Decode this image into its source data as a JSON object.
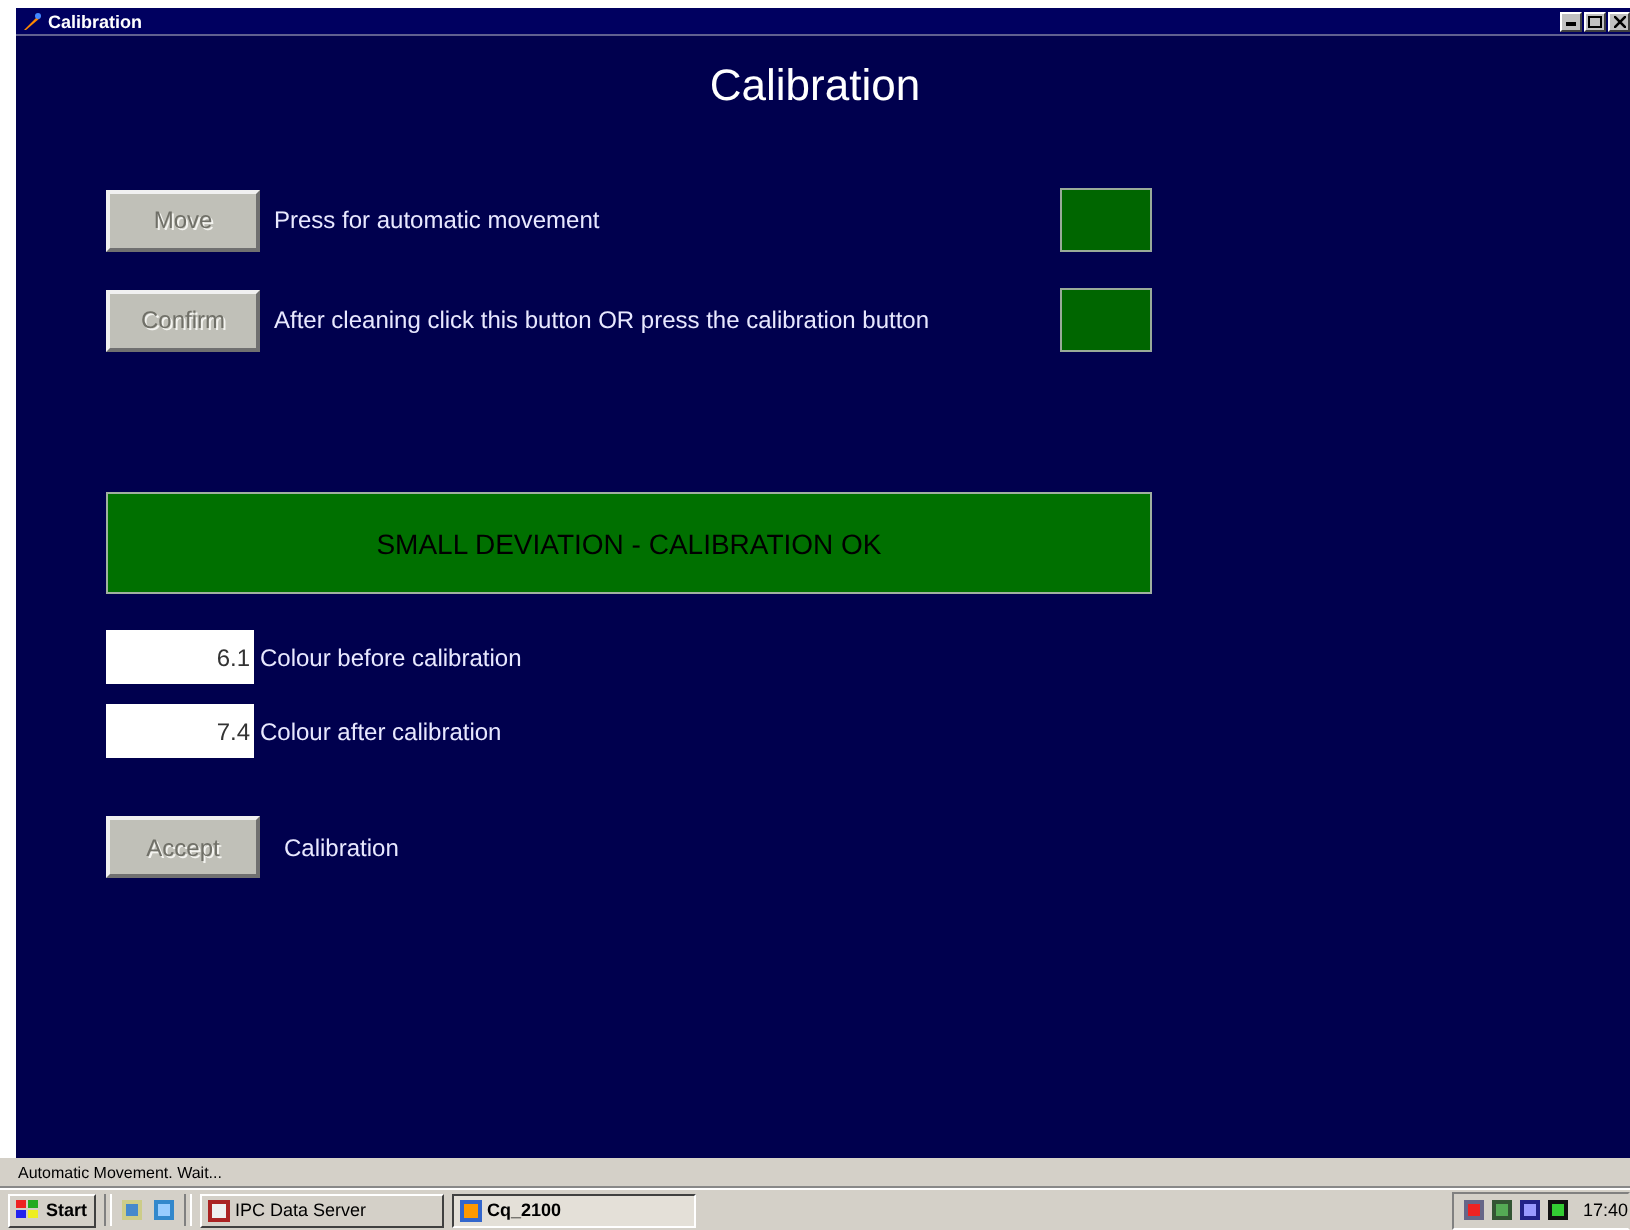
{
  "window": {
    "title": "Calibration"
  },
  "heading": "Calibration",
  "steps": [
    {
      "button": "Move",
      "disabled": true,
      "text": "Press for automatic movement",
      "color": "#006600"
    },
    {
      "button": "Confirm",
      "disabled": true,
      "text": "After cleaning click this button OR press the calibration button",
      "color": "#006600"
    }
  ],
  "result": {
    "text": "SMALL DEVIATION - CALIBRATION OK",
    "color": "#007000"
  },
  "readings": [
    {
      "value": "6.1",
      "label": "Colour before calibration"
    },
    {
      "value": "7.4",
      "label": "Colour after calibration"
    }
  ],
  "accept": {
    "button": "Accept",
    "disabled": true,
    "label": "Calibration"
  },
  "status_bar": "Automatic Movement. Wait...",
  "taskbar": {
    "start": "Start",
    "tasks": [
      {
        "label": "IPC Data Server",
        "selected": false
      },
      {
        "label": "Cq_2100",
        "selected": true
      }
    ],
    "clock": "17:40"
  }
}
